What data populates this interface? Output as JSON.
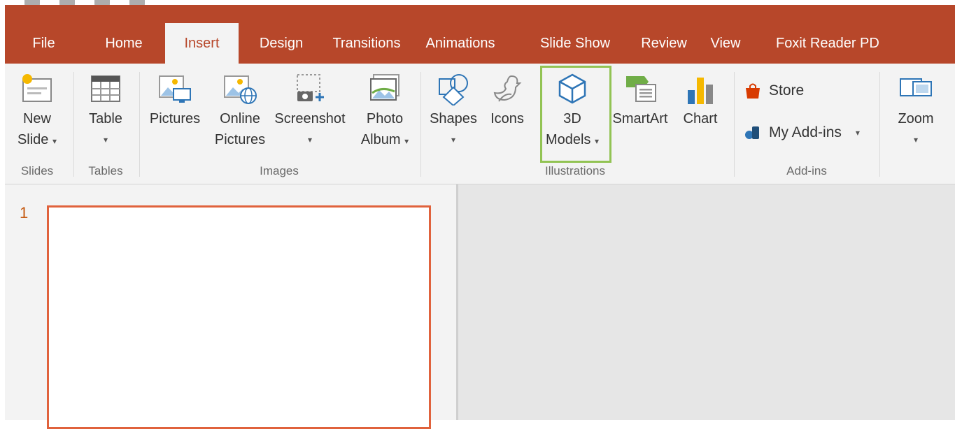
{
  "title_bar": {
    "quick_access": [
      "save-icon",
      "undo-icon",
      "redo-icon",
      "customize-icon"
    ]
  },
  "tabs": [
    {
      "label": "File"
    },
    {
      "label": "Home"
    },
    {
      "label": "Insert",
      "active": true
    },
    {
      "label": "Design"
    },
    {
      "label": "Transitions"
    },
    {
      "label": "Animations"
    },
    {
      "label": "Slide Show"
    },
    {
      "label": "Review"
    },
    {
      "label": "View"
    },
    {
      "label": "Foxit Reader PD"
    }
  ],
  "ribbon": {
    "slides": {
      "group_label": "Slides",
      "new_slide_line1": "New",
      "new_slide_line2": "Slide"
    },
    "tables": {
      "group_label": "Tables",
      "table_label": "Table"
    },
    "images": {
      "group_label": "Images",
      "pictures": "Pictures",
      "online_pictures_line1": "Online",
      "online_pictures_line2": "Pictures",
      "screenshot": "Screenshot",
      "photo_album_line1": "Photo",
      "photo_album_line2": "Album"
    },
    "illustrations": {
      "group_label": "Illustrations",
      "shapes": "Shapes",
      "icons": "Icons",
      "models_line1": "3D",
      "models_line2": "Models",
      "smartart": "SmartArt",
      "chart": "Chart"
    },
    "addins": {
      "group_label": "Add-ins",
      "store": "Store",
      "my_addins": "My Add-ins"
    },
    "zoom": {
      "label": "Zoom"
    }
  },
  "slides_pane": {
    "slide_number": "1"
  },
  "colors": {
    "accent": "#B7472A",
    "ribbon_bg": "#F3F3F3",
    "highlight": "#92C353",
    "slide_border": "#E0623C"
  }
}
